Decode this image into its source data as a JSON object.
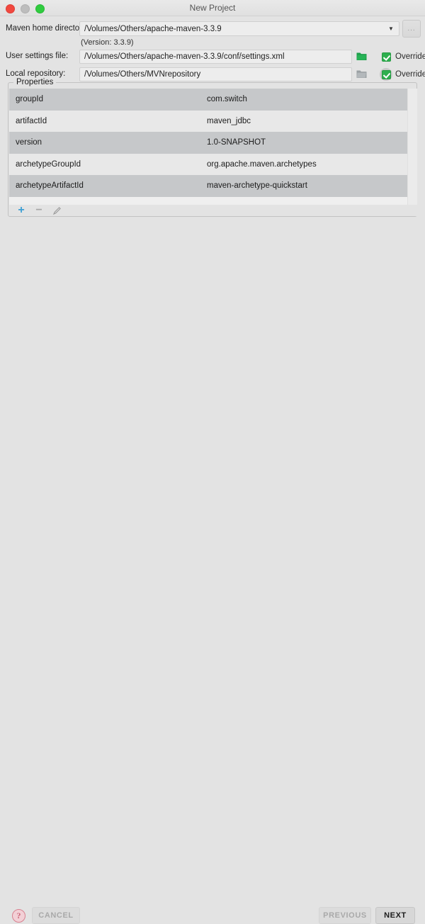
{
  "window": {
    "title": "New Project",
    "traffic_lights": [
      "close-red",
      "minimize-gray",
      "zoom-green"
    ]
  },
  "form": {
    "maven_home": {
      "label": "Maven home directory:",
      "value": "/Volumes/Others/apache-maven-3.3.9",
      "dropdown_icon": "chevron-down-icon",
      "browse_label": "...",
      "version_note": "(Version: 3.3.9)"
    },
    "user_settings": {
      "label": "User settings file:",
      "value": "/Volumes/Others/apache-maven-3.3.9/conf/settings.xml",
      "folder_icon": "folder-icon",
      "override_label": "Override",
      "override_checked": true
    },
    "local_repository": {
      "label": "Local repository:",
      "value": "/Volumes/Others/MVNrepository",
      "folder_icon": "folder-icon",
      "override_label": "Override",
      "override_checked": true
    }
  },
  "properties": {
    "group_title": "Properties",
    "rows": [
      {
        "key": "groupId",
        "value": "com.switch"
      },
      {
        "key": "artifactId",
        "value": "maven_jdbc"
      },
      {
        "key": "version",
        "value": "1.0-SNAPSHOT"
      },
      {
        "key": "archetypeGroupId",
        "value": "org.apache.maven.archetypes"
      },
      {
        "key": "archetypeArtifactId",
        "value": "maven-archetype-quickstart"
      }
    ],
    "toolbar": {
      "add_label": "+",
      "remove_label": "−",
      "edit_icon": "pencil-icon"
    }
  },
  "footer": {
    "help_label": "?",
    "cancel_label": "CANCEL",
    "previous_label": "PREVIOUS",
    "next_label": "NEXT"
  },
  "colors": {
    "window_bg": "#e3e3e3",
    "accent_green": "#2eaf4e",
    "accent_blue": "#3d9fd4",
    "help_pink": "#cc6678",
    "row_odd": "#c6c8ca",
    "row_even": "#e8e8e8"
  }
}
